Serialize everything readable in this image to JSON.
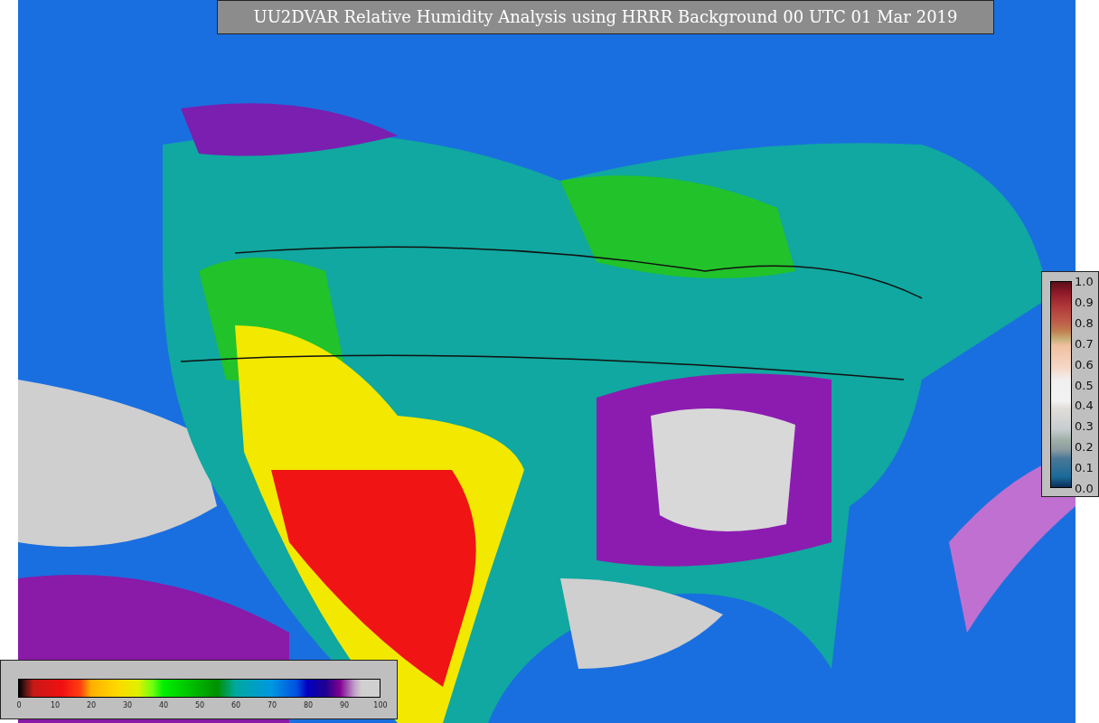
{
  "title": "UU2DVAR Relative Humidity Analysis using HRRR Background 00 UTC 01 Mar 2019",
  "humidity_legend": {
    "ticks": [
      "0",
      "10",
      "20",
      "30",
      "40",
      "50",
      "60",
      "70",
      "80",
      "90",
      "100"
    ]
  },
  "ratio_legend": {
    "ticks": [
      "1.0",
      "0.9",
      "0.8",
      "0.7",
      "0.6",
      "0.5",
      "0.4",
      "0.3",
      "0.2",
      "0.1",
      "0.0"
    ]
  }
}
